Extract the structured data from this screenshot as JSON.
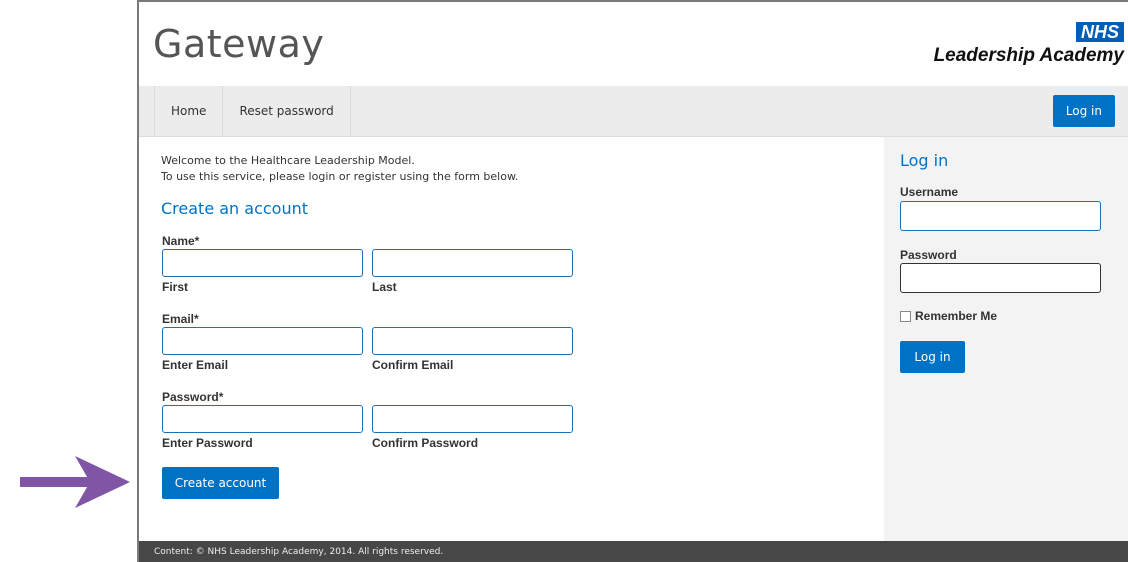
{
  "annotation": {
    "arrow_color": "#8155a6",
    "arrow_icon": "right-arrow-icon"
  },
  "header": {
    "site_title": "Gateway",
    "logo_badge": "NHS",
    "logo_subtitle": "Leadership Academy",
    "brand_color": "#005eb8"
  },
  "nav": {
    "items": [
      {
        "label": "Home"
      },
      {
        "label": "Reset password"
      }
    ],
    "login_label": "Log in"
  },
  "main": {
    "intro_line1": "Welcome to the Healthcare Leadership Model.",
    "intro_line2": "To use this service, please login or register using the form below.",
    "section_title": "Create an account",
    "name_label": "Name*",
    "first_label": "First",
    "last_label": "Last",
    "email_label": "Email*",
    "enter_email_label": "Enter Email",
    "confirm_email_label": "Confirm Email",
    "password_label": "Password*",
    "enter_password_label": "Enter Password",
    "confirm_password_label": "Confirm Password",
    "create_button": "Create account",
    "first_value": "",
    "last_value": "",
    "email_value": "",
    "confirm_email_value": "",
    "password_value": "",
    "confirm_password_value": ""
  },
  "sidebar": {
    "title": "Log in",
    "username_label": "Username",
    "username_value": "",
    "password_label": "Password",
    "password_value": "",
    "remember_label": "Remember Me",
    "remember_checked": false,
    "login_button": "Log in"
  },
  "footer": {
    "text": "Content: © NHS Leadership Academy, 2014. All rights reserved."
  },
  "colors": {
    "accent": "#0072c6",
    "footer_bg": "#474747",
    "nav_bg": "#ececec",
    "sidebar_bg": "#f3f3f3"
  }
}
